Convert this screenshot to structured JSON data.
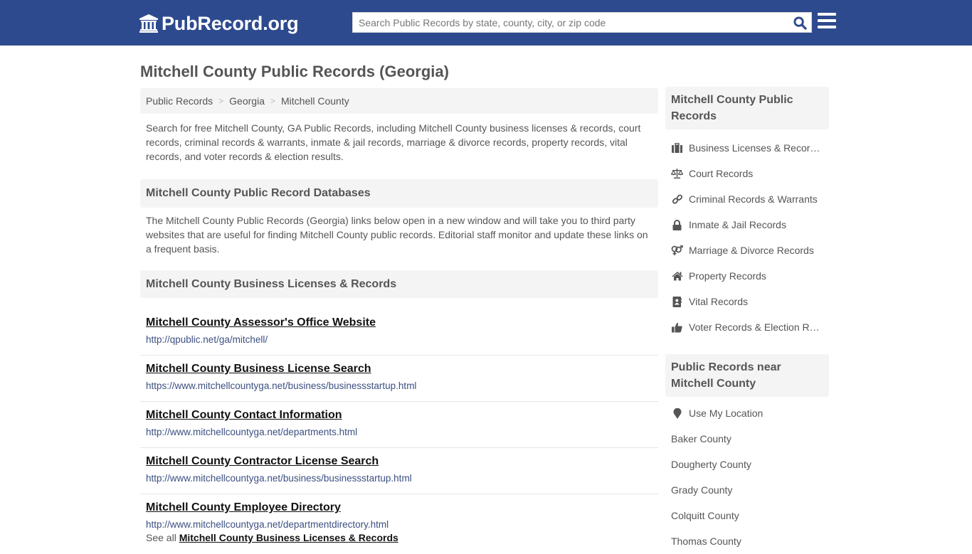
{
  "header": {
    "logo_text": "PubRecord.org",
    "logo_icon": "courthouse-icon",
    "search_placeholder": "Search Public Records by state, county, city, or zip code",
    "search_value": "",
    "search_icon": "search-icon",
    "menu_icon": "hamburger-menu-icon",
    "colors": {
      "brand": "#2e4a8e",
      "search_icon": "#2e4a8e"
    }
  },
  "page": {
    "title": "Mitchell County Public Records (Georgia)"
  },
  "breadcrumb": [
    {
      "label": "Public Records"
    },
    {
      "label": "Georgia"
    },
    {
      "label": "Mitchell County"
    }
  ],
  "breadcrumb_separator": ">",
  "intro": "Search for free Mitchell County, GA Public Records, including Mitchell County business licenses & records, court records, criminal records & warrants, inmate & jail records, marriage & divorce records, property records, vital records, and voter records & election results.",
  "databases": {
    "heading": "Mitchell County Public Record Databases",
    "note": "The Mitchell County Public Records (Georgia) links below open in a new window and will take you to third party websites that are useful for finding Mitchell County public records. Editorial staff monitor and update these links on a frequent basis."
  },
  "business_section": {
    "heading": "Mitchell County Business Licenses & Records",
    "links": [
      {
        "title": "Mitchell County Assessor's Office Website",
        "url": "http://qpublic.net/ga/mitchell/"
      },
      {
        "title": "Mitchell County Business License Search",
        "url": "https://www.mitchellcountyga.net/business/businessstartup.html"
      },
      {
        "title": "Mitchell County Contact Information",
        "url": "http://www.mitchellcountyga.net/departments.html"
      },
      {
        "title": "Mitchell County Contractor License Search",
        "url": "http://www.mitchellcountyga.net/business/businessstartup.html"
      },
      {
        "title": "Mitchell County Employee Directory",
        "url": "http://www.mitchellcountyga.net/departmentdirectory.html"
      }
    ],
    "see_all_prefix": "See all",
    "see_all_link": "Mitchell County Business Licenses & Records"
  },
  "sidebar": {
    "records_heading": "Mitchell County Public Records",
    "records": [
      {
        "label": "Business Licenses & Records",
        "icon": "briefcase-icon"
      },
      {
        "label": "Court Records",
        "icon": "balance-scale-icon"
      },
      {
        "label": "Criminal Records & Warrants",
        "icon": "link-icon"
      },
      {
        "label": "Inmate & Jail Records",
        "icon": "lock-icon"
      },
      {
        "label": "Marriage & Divorce Records",
        "icon": "gender-icon"
      },
      {
        "label": "Property Records",
        "icon": "home-icon"
      },
      {
        "label": "Vital Records",
        "icon": "address-book-icon"
      },
      {
        "label": "Voter Records & Election Results",
        "icon": "thumbs-up-icon"
      }
    ],
    "near_heading": "Public Records near Mitchell County",
    "use_location": {
      "label": "Use My Location",
      "icon": "map-marker-icon"
    },
    "nearby_counties": [
      "Baker County",
      "Dougherty County",
      "Grady County",
      "Colquitt County",
      "Thomas County"
    ]
  }
}
